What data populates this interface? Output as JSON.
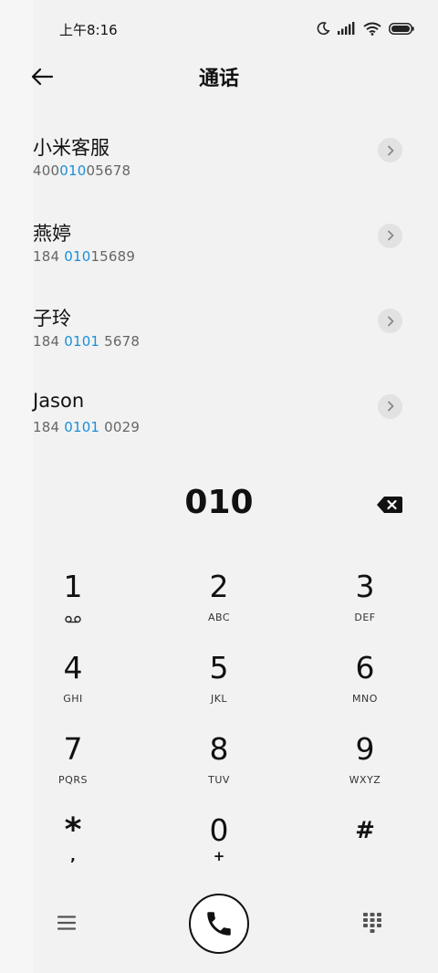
{
  "status_bar": {
    "time": "上午8:16",
    "icons": [
      "moon-icon",
      "signal-icon",
      "wifi-icon",
      "battery-icon"
    ]
  },
  "header": {
    "title": "通话",
    "back_icon": "arrow-left-icon"
  },
  "results": [
    {
      "name": "小米客服",
      "number_pre": "400",
      "number_match": "010",
      "number_post": "05678"
    },
    {
      "name": "燕婷",
      "number_pre": "184 ",
      "number_match": "010",
      "number_post": "15689"
    },
    {
      "name": "子玲",
      "number_pre": "184 ",
      "number_match": "0101",
      "number_post": " 5678"
    },
    {
      "name": "Jason",
      "number_pre": "184 ",
      "number_match": "0101",
      "number_post": " 0029"
    }
  ],
  "dialed_number": "010",
  "keypad": {
    "keys": [
      {
        "digit": "1",
        "letters": ""
      },
      {
        "digit": "2",
        "letters": "ABC"
      },
      {
        "digit": "3",
        "letters": "DEF"
      },
      {
        "digit": "4",
        "letters": "GHI"
      },
      {
        "digit": "5",
        "letters": "JKL"
      },
      {
        "digit": "6",
        "letters": "MNO"
      },
      {
        "digit": "7",
        "letters": "PQRS"
      },
      {
        "digit": "8",
        "letters": "TUV"
      },
      {
        "digit": "9",
        "letters": "WXYZ"
      },
      {
        "digit": "*",
        "letters": ","
      },
      {
        "digit": "0",
        "letters": "+"
      },
      {
        "digit": "#",
        "letters": ""
      }
    ],
    "voicemail_icon": "voicemail-icon"
  },
  "bottom_bar": {
    "menu_icon": "menu-icon",
    "call_icon": "phone-icon",
    "dialpad_icon": "dialpad-icon"
  },
  "colors": {
    "background": "#f2f2f2",
    "highlight": "#1a8fd8",
    "detail_button": "#e2e2e2"
  }
}
